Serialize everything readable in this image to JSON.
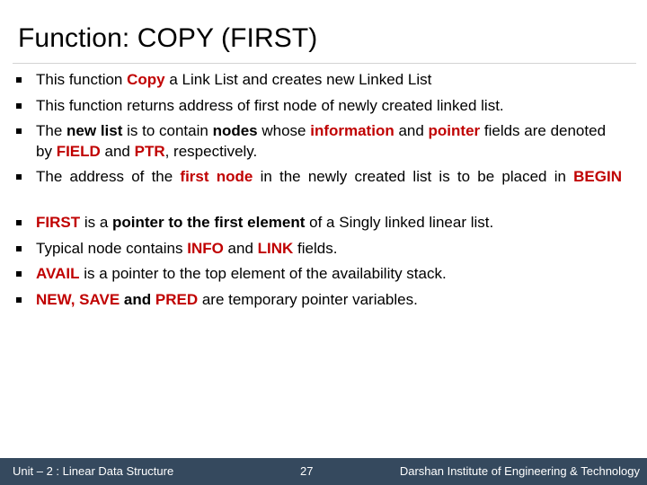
{
  "slide": {
    "title": "Function: COPY (FIRST)",
    "accent_red": "#C00000",
    "footer_bg": "#35495E",
    "background": "#FFFFFF",
    "bullet_marker": "square"
  },
  "bullets": [
    {
      "id": "bullet-copy-link-list",
      "align": "left",
      "segments": [
        {
          "text": "This function ",
          "style": "normal"
        },
        {
          "text": "Copy",
          "style": "bold-red"
        },
        {
          "text": " a Link List and creates new Linked List",
          "style": "normal"
        }
      ],
      "plain": "This function Copy a Link List and creates new Linked List"
    },
    {
      "id": "bullet-returns-address",
      "align": "left",
      "segments": [
        {
          "text": "This function returns address of first node of newly created linked list.",
          "style": "normal"
        }
      ],
      "plain": "This function returns address of first node of newly created linked list."
    },
    {
      "id": "bullet-new-list-fields",
      "align": "left",
      "segments": [
        {
          "text": "The ",
          "style": "normal"
        },
        {
          "text": "new list",
          "style": "bold-black"
        },
        {
          "text": " is to contain ",
          "style": "normal"
        },
        {
          "text": "nodes",
          "style": "bold-black"
        },
        {
          "text": " whose ",
          "style": "normal"
        },
        {
          "text": "information",
          "style": "bold-red"
        },
        {
          "text": " and ",
          "style": "normal"
        },
        {
          "text": "pointer",
          "style": "bold-red"
        },
        {
          "text": " fields are denoted by ",
          "style": "normal"
        },
        {
          "text": "FIELD",
          "style": "bold-red"
        },
        {
          "text": " and ",
          "style": "normal"
        },
        {
          "text": "PTR",
          "style": "bold-red"
        },
        {
          "text": ", respectively.",
          "style": "normal"
        }
      ],
      "plain": "The new list is to contain nodes whose information and pointer fields are denoted by FIELD and PTR, respectively."
    },
    {
      "id": "bullet-first-node-begin",
      "align": "justify",
      "segments": [
        {
          "text": "The address of the ",
          "style": "normal"
        },
        {
          "text": "first node",
          "style": "bold-red"
        },
        {
          "text": " in the newly created list is to be placed in ",
          "style": "normal"
        },
        {
          "text": "BEGIN",
          "style": "bold-red"
        }
      ],
      "plain": "The address of the first node in the newly created list is to be placed in BEGIN"
    },
    {
      "id": "bullet-first-pointer",
      "align": "left",
      "segments": [
        {
          "text": "FIRST",
          "style": "bold-red"
        },
        {
          "text": " is a ",
          "style": "normal"
        },
        {
          "text": "pointer to the first element",
          "style": "bold-black"
        },
        {
          "text": " of a Singly linked linear list.",
          "style": "normal"
        }
      ],
      "plain": "FIRST is a pointer to the first element of a Singly linked linear list."
    },
    {
      "id": "bullet-typical-node",
      "align": "left",
      "segments": [
        {
          "text": "Typical node contains ",
          "style": "normal"
        },
        {
          "text": "INFO",
          "style": "bold-red"
        },
        {
          "text": " and ",
          "style": "normal"
        },
        {
          "text": "LINK",
          "style": "bold-red"
        },
        {
          "text": " fields.",
          "style": "normal"
        }
      ],
      "plain": "Typical node contains INFO and LINK fields."
    },
    {
      "id": "bullet-avail-pointer",
      "align": "left",
      "segments": [
        {
          "text": "AVAIL",
          "style": "bold-red"
        },
        {
          "text": " is a pointer to the top element of the availability stack.",
          "style": "normal"
        }
      ],
      "plain": "AVAIL is a pointer to the top element of the availability stack."
    },
    {
      "id": "bullet-temp-pointers",
      "align": "left",
      "segments": [
        {
          "text": "NEW, SAVE",
          "style": "bold-red"
        },
        {
          "text": " and ",
          "style": "bold-black"
        },
        {
          "text": "PRED",
          "style": "bold-red"
        },
        {
          "text": " are temporary pointer variables.",
          "style": "normal"
        }
      ],
      "plain": "NEW, SAVE and PRED are temporary pointer variables."
    }
  ],
  "footer": {
    "left": "Unit – 2 : Linear Data Structure",
    "page_number": "27",
    "right": "Darshan Institute of Engineering & Technology"
  }
}
